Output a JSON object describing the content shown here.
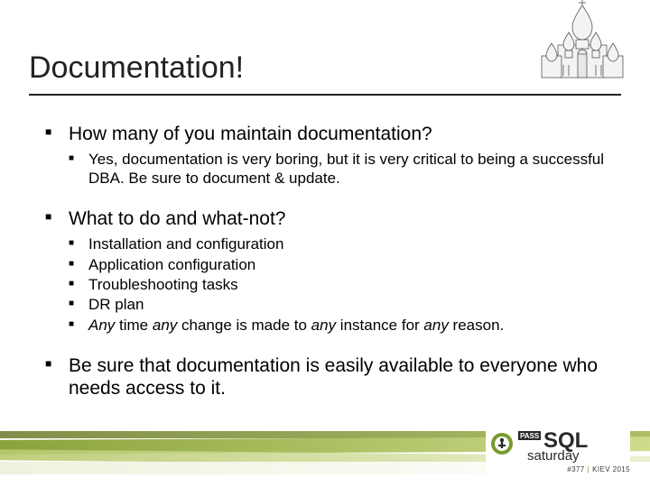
{
  "title": "Documentation!",
  "bullets": {
    "b1": {
      "text": "How many of you maintain documentation?",
      "sub": [
        "Yes, documentation is very boring, but it is very critical to being a successful DBA. Be sure to document & update."
      ]
    },
    "b2": {
      "text": "What to do and what-not?",
      "sub": [
        "Installation and configuration",
        "Application configuration",
        "Troubleshooting tasks",
        "DR plan"
      ],
      "sub_emph": {
        "prefix": "Any",
        "mid1": " time ",
        "em2": "any",
        "mid2": " change is made to ",
        "em3": "any",
        "mid3": " instance for ",
        "em4": "any",
        "tail": " reason."
      }
    },
    "b3": {
      "text": "Be sure that documentation is easily available to everyone who needs access to it."
    }
  },
  "logo": {
    "pass": "PASS",
    "sql": "SQL",
    "saturday": "saturday",
    "event_no": "#377",
    "city": "KIEV",
    "year": "2015"
  }
}
